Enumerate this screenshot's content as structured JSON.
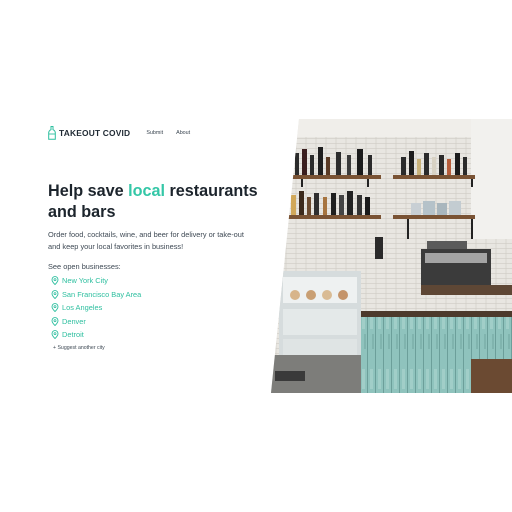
{
  "header": {
    "brand": "TAKEOUT COVID",
    "nav": [
      "Submit",
      "About"
    ]
  },
  "hero": {
    "title_prefix": "Help save ",
    "title_accent": "local",
    "title_suffix": " restaurants and bars",
    "description": "Order food, cocktails, wine, and beer for delivery or take-out and keep your local favorites in business!",
    "open_label": "See open businesses:",
    "cities": [
      "New York City",
      "San Francisco Bay Area",
      "Los Angeles",
      "Denver",
      "Detroit"
    ],
    "suggest": "+ Suggest another city"
  },
  "colors": {
    "accent": "#34c7a7",
    "text": "#1f2933"
  },
  "icons": {
    "logo": "bottle-icon",
    "city": "map-pin-icon"
  }
}
